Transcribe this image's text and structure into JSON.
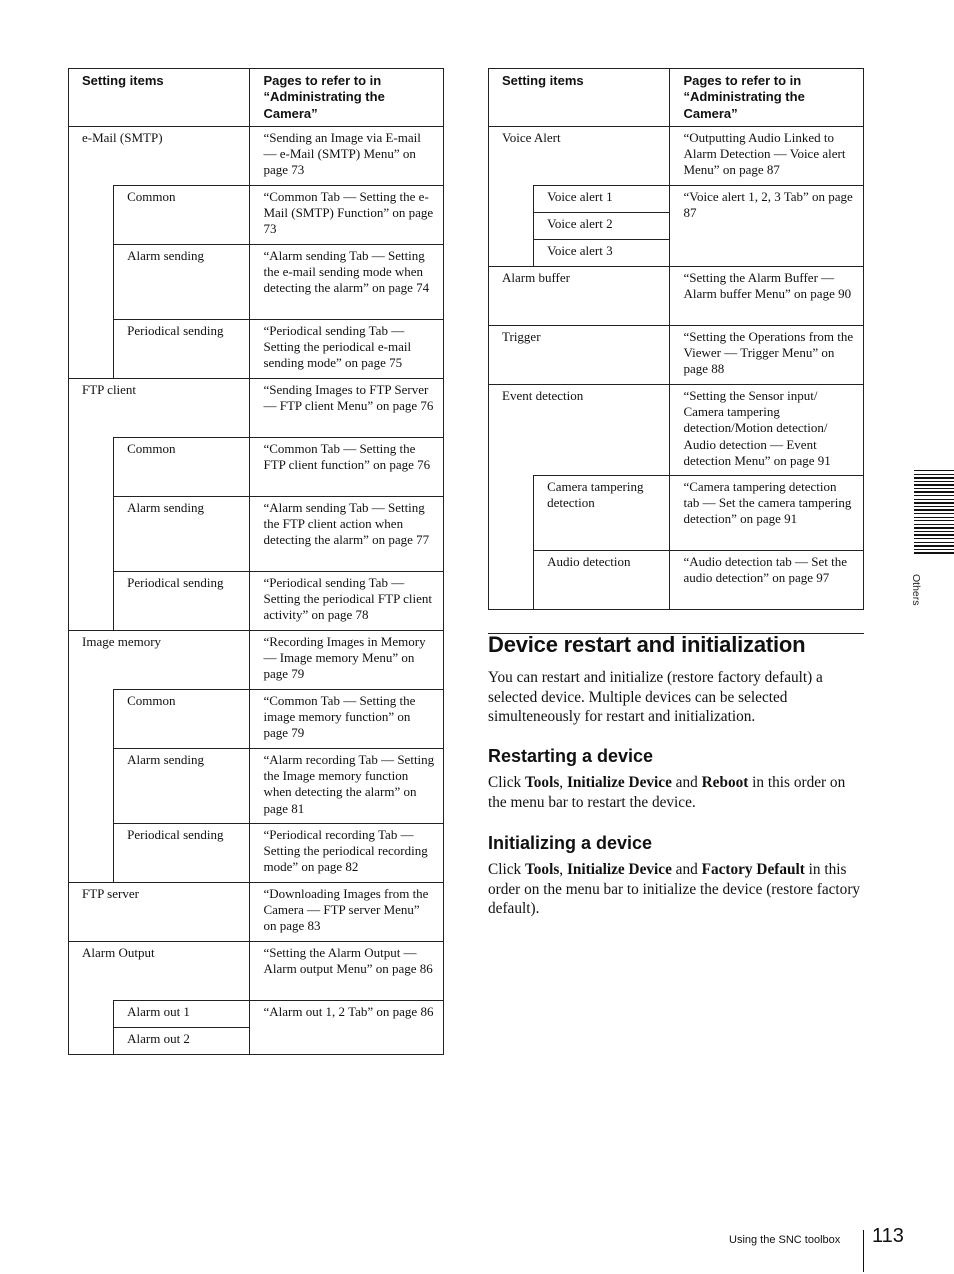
{
  "left_table": {
    "headers": [
      "Setting items",
      "Pages to refer to in “Administrating the Camera”"
    ],
    "groups": [
      {
        "item": "e-Mail (SMTP)",
        "ref": "“Sending an Image via E-mail — e-Mail (SMTP) Menu” on page 73",
        "subs": [
          {
            "item": "Common",
            "ref": "“Common Tab — Setting the e-Mail (SMTP) Function” on page 73"
          },
          {
            "item": "Alarm sending",
            "ref": "“Alarm sending Tab — Setting the e-mail sending mode when detecting the alarm” on page 74"
          },
          {
            "item": "Periodical sending",
            "ref": "“Periodical sending Tab — Setting the periodical e-mail sending mode” on page 75"
          }
        ]
      },
      {
        "item": "FTP client",
        "ref": "“Sending Images to FTP Server — FTP client Menu” on page 76",
        "subs": [
          {
            "item": "Common",
            "ref": "“Common Tab — Setting the FTP client function” on page 76"
          },
          {
            "item": "Alarm sending",
            "ref": "“Alarm sending Tab — Setting the FTP client action when detecting the alarm” on page 77"
          },
          {
            "item": "Periodical sending",
            "ref": "“Periodical sending Tab — Setting the periodical FTP client activity” on page 78"
          }
        ]
      },
      {
        "item": "Image memory",
        "ref": "“Recording Images in Memory — Image memory Menu” on page 79",
        "subs": [
          {
            "item": "Common",
            "ref": "“Common Tab — Setting the image memory function” on page 79"
          },
          {
            "item": "Alarm sending",
            "ref": "“Alarm recording Tab — Setting the Image memory function when detecting the alarm” on page 81"
          },
          {
            "item": "Periodical sending",
            "ref": "“Periodical recording Tab — Setting the periodical recording mode” on page 82"
          }
        ]
      },
      {
        "item": "FTP server",
        "ref": "“Downloading Images from the Camera — FTP server Menu” on page 83",
        "subs": []
      },
      {
        "item": "Alarm Output",
        "ref": "“Setting the Alarm Output — Alarm output Menu” on page 86",
        "subs": [
          {
            "item": "Alarm out 1"
          },
          {
            "item": "Alarm out 2"
          }
        ],
        "shared_ref": "“Alarm out 1, 2 Tab” on page 86"
      }
    ]
  },
  "right_table": {
    "headers": [
      "Setting items",
      "Pages to refer to in “Administrating the Camera”"
    ],
    "groups": [
      {
        "item": "Voice Alert",
        "ref": "“Outputting Audio Linked to Alarm Detection — Voice alert Menu” on page 87",
        "subs": [
          {
            "item": "Voice alert 1"
          },
          {
            "item": "Voice alert 2"
          },
          {
            "item": "Voice alert 3"
          }
        ],
        "shared_ref": "“Voice alert 1, 2, 3 Tab” on page 87"
      },
      {
        "item": "Alarm buffer",
        "ref": "“Setting the Alarm Buffer — Alarm buffer Menu” on page 90",
        "subs": []
      },
      {
        "item": "Trigger",
        "ref": "“Setting the Operations from the Viewer — Trigger Menu” on page 88",
        "subs": []
      },
      {
        "item": "Event detection",
        "ref": "“Setting the Sensor input/ Camera tampering detection/Motion detection/ Audio detection — Event detection Menu” on page 91",
        "subs": [
          {
            "item": "Camera tampering detection",
            "ref": "“Camera tampering detection tab — Set the camera tampering detection” on page 91"
          },
          {
            "item": "Audio detection",
            "ref": "“Audio detection tab — Set the audio detection” on page 97"
          }
        ]
      }
    ]
  },
  "section": {
    "title": "Device restart and initialization",
    "intro": "You can restart and initialize (restore factory default) a selected device. Multiple devices can be selected simulteneously for restart and initialization.",
    "restart": {
      "title": "Restarting a device",
      "p1": "Click ",
      "b1": "Tools",
      "p2": ", ",
      "b2": "Initialize Device",
      "p3": " and ",
      "b3": "Reboot",
      "p4": " in this order on the menu bar to restart the device."
    },
    "initialize": {
      "title": "Initializing a device",
      "p1": "Click ",
      "b1": "Tools",
      "p2": ", ",
      "b2": "Initialize Device",
      "p3": " and ",
      "b3": "Factory Default",
      "p4": " in this order on the menu bar to initialize the device (restore factory default)."
    }
  },
  "side_tab": {
    "label": "Others"
  },
  "footer": {
    "section": "Using the SNC toolbox",
    "page_number": "113"
  }
}
